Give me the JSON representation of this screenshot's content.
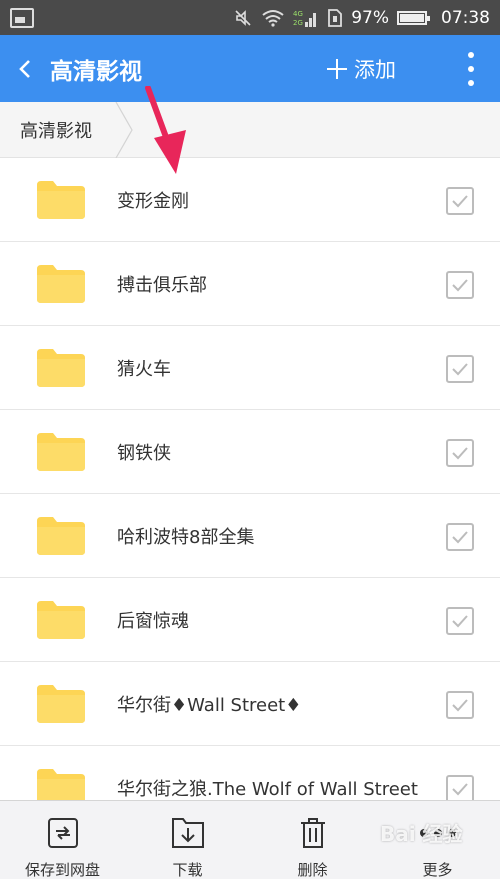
{
  "status_bar": {
    "battery": "97%",
    "time": "07:38"
  },
  "app_bar": {
    "title": "高清影视",
    "add_label": "添加"
  },
  "breadcrumb": {
    "current": "高清影视"
  },
  "folders": [
    {
      "name": "变形金刚"
    },
    {
      "name": "搏击俱乐部"
    },
    {
      "name": "猜火车"
    },
    {
      "name": "钢铁侠"
    },
    {
      "name": "哈利波特8部全集"
    },
    {
      "name": "后窗惊魂"
    },
    {
      "name": "华尔街♦Wall Street♦"
    },
    {
      "name": "华尔街之狼.The Wolf of Wall Street"
    }
  ],
  "bottom_bar": {
    "save": "保存到网盘",
    "download": "下载",
    "delete": "删除",
    "more": "更多"
  },
  "watermark": "Bai 经验",
  "colors": {
    "accent": "#3c8ff0",
    "folder": "#fdd555",
    "pointer": "#e8265a"
  }
}
